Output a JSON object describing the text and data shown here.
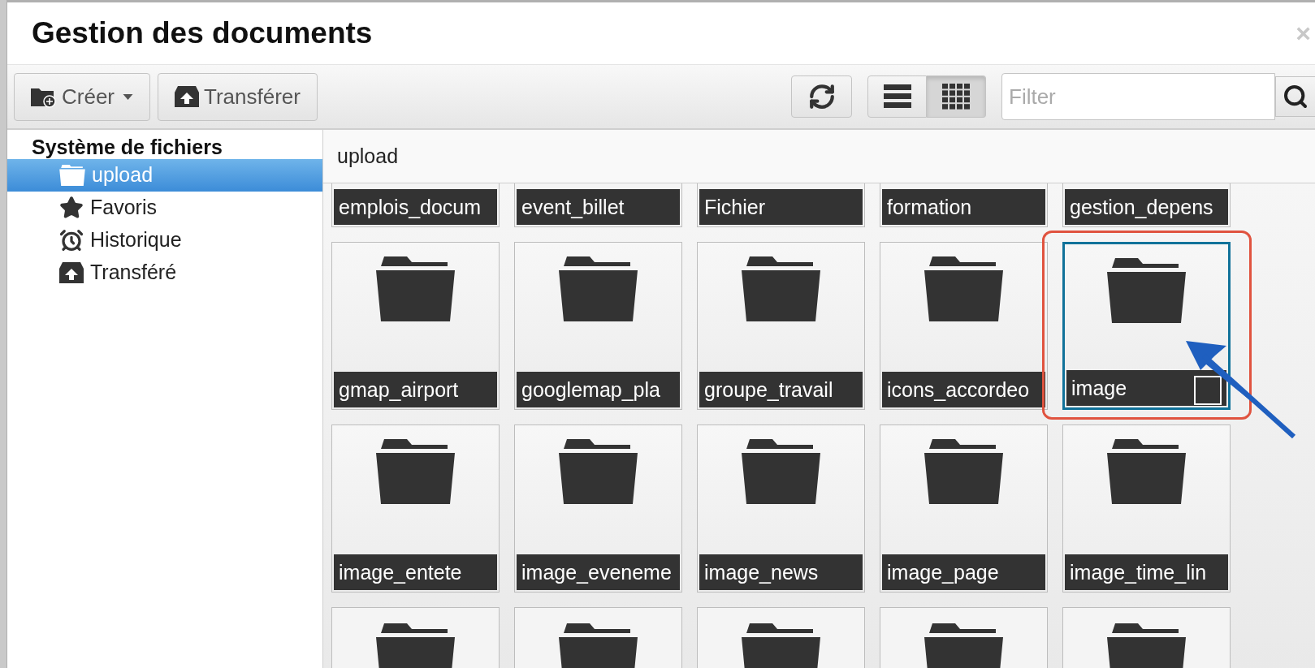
{
  "window": {
    "title": "Gestion des documents",
    "close": "×"
  },
  "toolbar": {
    "buttons": [
      {
        "label": "Créer",
        "caret": true
      },
      {
        "label": "Transférer",
        "caret": false
      }
    ],
    "views": [
      {
        "selected": false
      },
      {
        "selected": true
      }
    ],
    "filter": {
      "placeholder": "Filter"
    }
  },
  "sidebar": {
    "root": "Système de fichiers",
    "items": [
      {
        "label": "upload",
        "selected": true
      },
      {
        "label": "Favoris",
        "selected": false
      },
      {
        "label": "Historique",
        "selected": false
      },
      {
        "label": "Transféré",
        "selected": false
      }
    ]
  },
  "path": "upload",
  "rows": [
    {
      "kind": "cut-top",
      "tiles": [
        {
          "kind": "folder",
          "name": "emplois_docum",
          "selected": false
        },
        {
          "kind": "folder",
          "name": "event_billet",
          "selected": false
        },
        {
          "kind": "folder",
          "name": "Fichier",
          "selected": false
        },
        {
          "kind": "folder",
          "name": "formation",
          "selected": false
        },
        {
          "kind": "folder",
          "name": "gestion_depens",
          "selected": false
        }
      ]
    },
    {
      "kind": "full",
      "tiles": [
        {
          "kind": "folder",
          "name": "gmap_airport",
          "selected": false
        },
        {
          "kind": "folder",
          "name": "googlemap_pla",
          "selected": false
        },
        {
          "kind": "folder",
          "name": "groupe_travail",
          "selected": false
        },
        {
          "kind": "folder",
          "name": "icons_accordeo",
          "selected": false
        },
        {
          "kind": "folder",
          "name": "image",
          "selected": true
        }
      ]
    },
    {
      "kind": "full",
      "tiles": [
        {
          "kind": "folder",
          "name": "image_entete",
          "selected": false
        },
        {
          "kind": "folder",
          "name": "image_eveneme",
          "selected": false
        },
        {
          "kind": "folder",
          "name": "image_news",
          "selected": false
        },
        {
          "kind": "folder",
          "name": "image_page",
          "selected": false
        },
        {
          "kind": "folder",
          "name": "image_time_lin",
          "selected": false
        }
      ]
    },
    {
      "kind": "cut-bottom",
      "tiles": [
        {
          "kind": "folder",
          "selected": false
        },
        {
          "kind": "folder",
          "selected": false
        },
        {
          "kind": "folder",
          "selected": false
        },
        {
          "kind": "folder",
          "selected": false
        },
        {
          "kind": "folder",
          "selected": false
        }
      ]
    }
  ],
  "callouts": [
    {
      "kind": "box",
      "color": "#e0533f"
    },
    {
      "kind": "arrow",
      "color": "#1f5fbf"
    }
  ]
}
